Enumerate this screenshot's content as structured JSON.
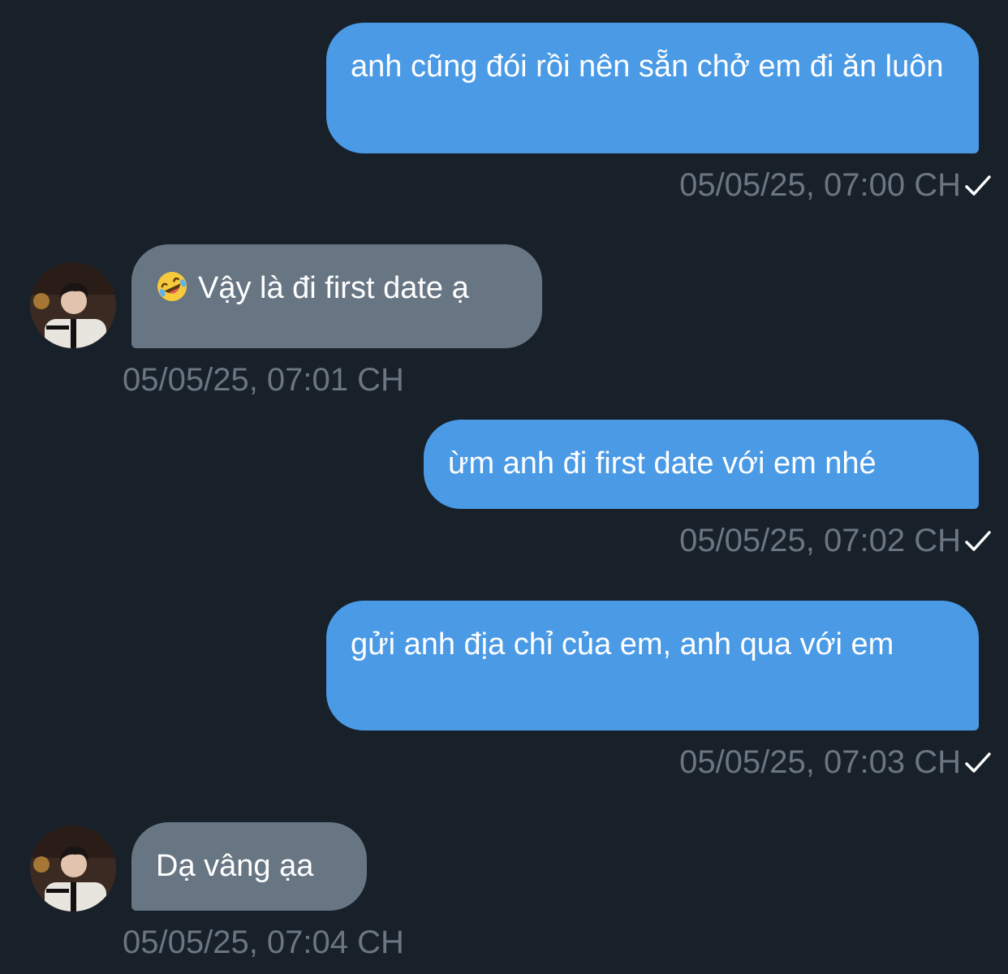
{
  "messages": [
    {
      "direction": "outgoing",
      "text": "anh cũng đói rồi nên sẵn chở em đi ăn luôn",
      "time": "05/05/25, 07:00 CH",
      "status_icon": "checkmark-icon"
    },
    {
      "direction": "incoming",
      "emoji": "rolling-on-floor-laughing-emoji",
      "text": "Vậy là đi first date ạ",
      "time": "05/05/25, 07:01 CH",
      "avatar": "avatar"
    },
    {
      "direction": "outgoing",
      "text": "ừm anh đi first date với em nhé",
      "time": "05/05/25, 07:02 CH",
      "status_icon": "checkmark-icon"
    },
    {
      "direction": "outgoing",
      "text": "gửi anh địa chỉ của em, anh qua với em",
      "time": "05/05/25, 07:03 CH",
      "status_icon": "checkmark-icon"
    },
    {
      "direction": "incoming",
      "text": "Dạ vâng ạa",
      "time": "05/05/25, 07:04 CH",
      "avatar": "avatar"
    }
  ],
  "colors": {
    "background": "#18202a",
    "outgoing_bubble": "#4a9ae6",
    "incoming_bubble": "#687684",
    "timestamp": "#6b7682",
    "text": "#ffffff"
  }
}
